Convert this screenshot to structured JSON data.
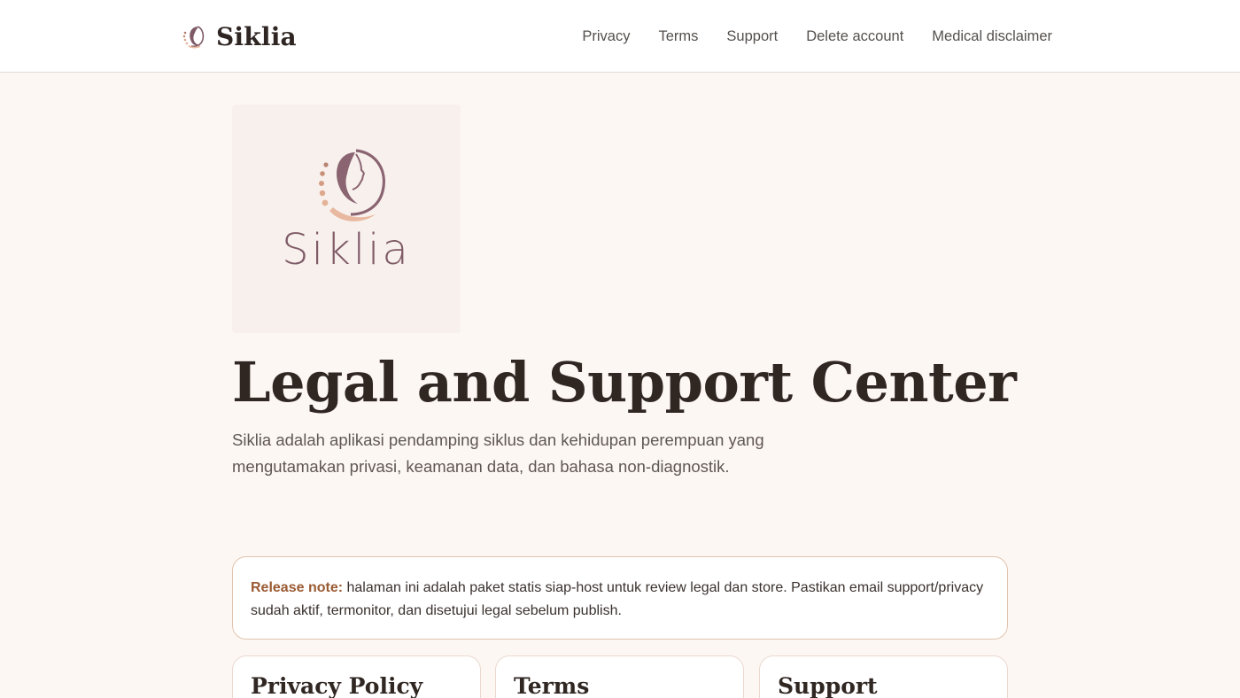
{
  "header": {
    "brand_name": "Siklia",
    "nav": [
      {
        "label": "Privacy"
      },
      {
        "label": "Terms"
      },
      {
        "label": "Support"
      },
      {
        "label": "Delete account"
      },
      {
        "label": "Medical disclaimer"
      }
    ]
  },
  "hero": {
    "logo_wordmark": "Siklia",
    "title": "Legal and Support Center",
    "subtitle": "Siklia adalah aplikasi pendamping siklus dan kehidupan perempuan yang mengutamakan privasi, keamanan data, dan bahasa non-diagnostik."
  },
  "release_note": {
    "label": "Release note:",
    "text": " halaman ini adalah paket statis siap-host untuk review legal dan store. Pastikan email support/privacy sudah aktif, termonitor, dan disetujui legal sebelum publish."
  },
  "cards": [
    {
      "title": "Privacy Policy"
    },
    {
      "title": "Terms"
    },
    {
      "title": "Support"
    }
  ],
  "colors": {
    "page_background": "#fdf7f3",
    "accent_brown": "#9a5a32",
    "logo_mauve": "#7e5a67",
    "logo_peach": "#e8b9a0"
  }
}
